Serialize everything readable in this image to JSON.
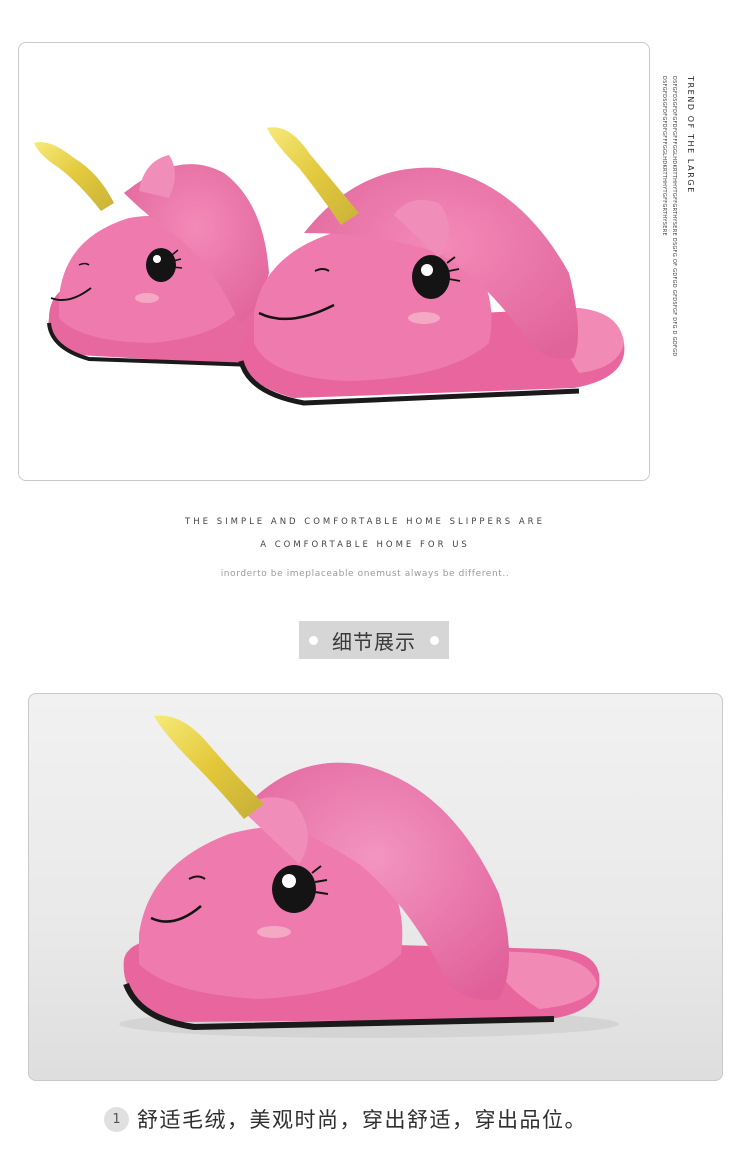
{
  "side_panel": {
    "title": "TREND OF THE LARGE",
    "line1": "DSFGFDSGFDFGFDFGFFFGGLHDKRTTHHYTGFFGRTHYSERE DSGFG OF GDFGD GFDSFGF DFG D GDFGD",
    "line2": "DSFGFDSGFDFGFDFGFFFGGLHDKRTTHHYTGFFGRTHYSERE"
  },
  "taglines": {
    "line1": "THE SIMPLE AND COMFORTABLE HOME SLIPPERS ARE",
    "line2": "A COMFORTABLE HOME FOR US",
    "line3": "inorderto be imeplaceable onemust always be different.."
  },
  "section": {
    "title": "细节展示"
  },
  "detail": {
    "number": "1",
    "caption": "舒适毛绒，美观时尚，穿出舒适，穿出品位。"
  },
  "colors": {
    "slipper_pink": "#ec6fa6",
    "fur_pink": "#e8649d",
    "horn_gold": "#e8d34a",
    "badge_gray": "#d6d6d6"
  }
}
